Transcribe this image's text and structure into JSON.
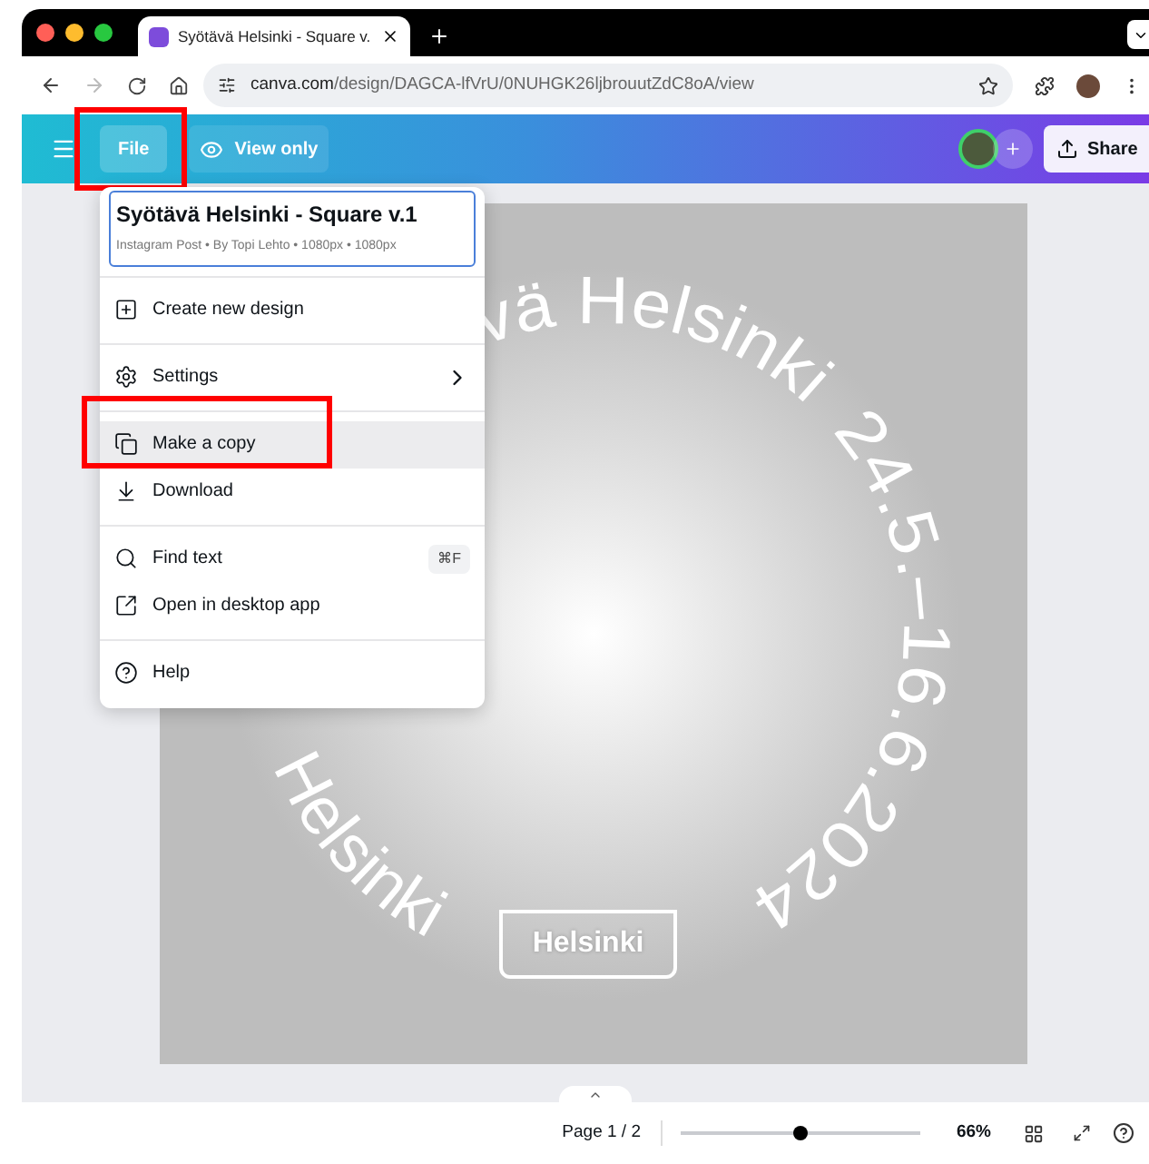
{
  "browser": {
    "tab_title": "Syötävä Helsinki - Square v.",
    "url_domain": "canva.com",
    "url_path": "/design/DAGCA-lfVrU/0NUHGK26ljbrouutZdC8oA/view"
  },
  "toolbar": {
    "file_button": {
      "label": "File",
      "annotated": true
    },
    "view_mode": "View only",
    "share": "Share"
  },
  "file_menu": {
    "title": "Syötävä Helsinki - Square v.1",
    "subtitle": "Instagram Post • By Topi Lehto • 1080px • 1080px",
    "groups": [
      [
        {
          "kind": "item",
          "label": "Create new design",
          "highlighted": false,
          "annotated": false
        }
      ],
      [
        {
          "kind": "submenu",
          "label": "Settings",
          "highlighted": false,
          "annotated": false
        }
      ],
      [
        {
          "kind": "item",
          "label": "Make a copy",
          "highlighted": true,
          "annotated": true
        },
        {
          "kind": "item",
          "label": "Download",
          "highlighted": false,
          "annotated": false
        }
      ],
      [
        {
          "kind": "shortcut",
          "label": "Find text",
          "shortcut": "⌘F",
          "highlighted": false,
          "annotated": false
        },
        {
          "kind": "item",
          "label": "Open in desktop app",
          "highlighted": false,
          "annotated": false
        }
      ],
      [
        {
          "kind": "item",
          "label": "Help",
          "highlighted": false,
          "annotated": false
        }
      ]
    ]
  },
  "design": {
    "arc_text_name": "vä Helsinki",
    "arc_text_dates": "24.5.–16.6.2024",
    "arc_text_bottom": "Helsinki",
    "badge": "Helsinki"
  },
  "footer": {
    "page": "Page 1 / 2",
    "zoom": {
      "level": 0.5
    },
    "zoom_reading": "66%"
  }
}
